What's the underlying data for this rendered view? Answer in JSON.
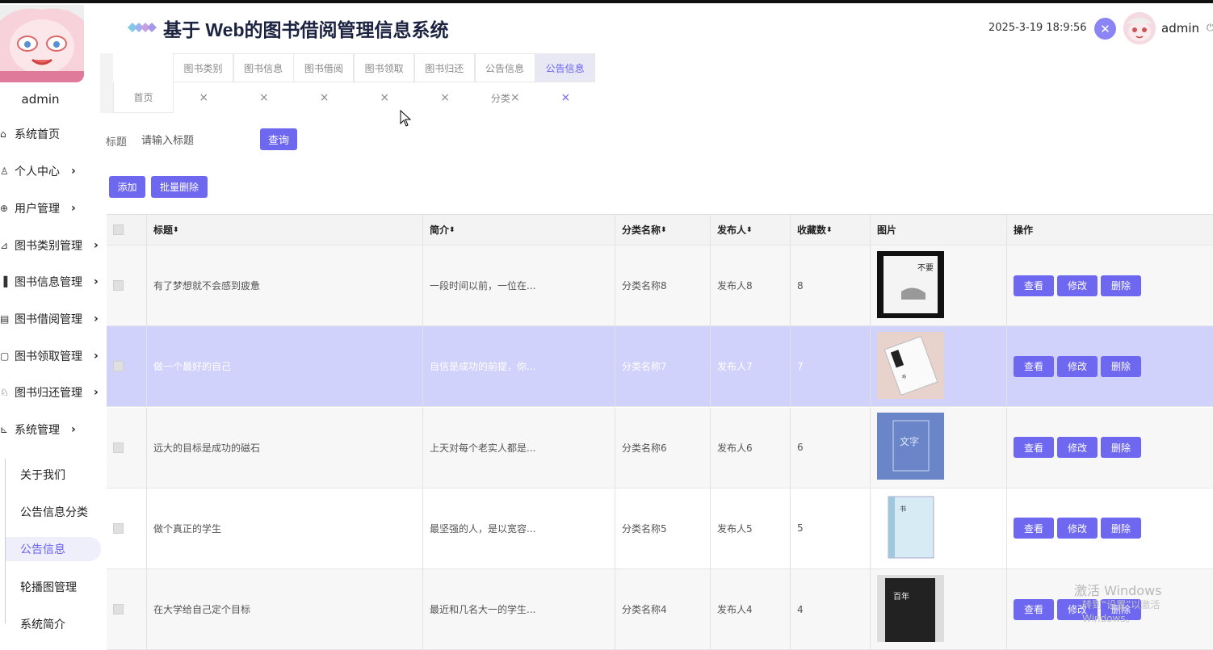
{
  "app": {
    "title": "基于 Web的图书借阅管理信息系统",
    "datetime": "2025-3-19 18:9:56",
    "user": "admin"
  },
  "sidebar": {
    "username": "admin",
    "items": [
      {
        "label": "系统首页",
        "icon": "home-icon",
        "arrow": false
      },
      {
        "label": "个人中心",
        "icon": "user-icon",
        "arrow": true
      },
      {
        "label": "用户管理",
        "icon": "users-icon",
        "arrow": true
      },
      {
        "label": "图书类别管理",
        "icon": "chart-icon",
        "arrow": true
      },
      {
        "label": "图书信息管理",
        "icon": "bar-icon",
        "arrow": true
      },
      {
        "label": "图书借阅管理",
        "icon": "book-icon",
        "arrow": true
      },
      {
        "label": "图书领取管理",
        "icon": "box-icon",
        "arrow": true
      },
      {
        "label": "图书归还管理",
        "icon": "return-icon",
        "arrow": true
      },
      {
        "label": "系统管理",
        "icon": "system-icon",
        "arrow": true
      }
    ],
    "subitems": [
      {
        "label": "关于我们",
        "active": false
      },
      {
        "label": "公告信息分类",
        "active": false
      },
      {
        "label": "公告信息",
        "active": true
      },
      {
        "label": "轮播图管理",
        "active": false
      },
      {
        "label": "系统简介",
        "active": false
      }
    ]
  },
  "tabs_top": [
    {
      "label": "图书类别",
      "active": false
    },
    {
      "label": "图书信息",
      "active": false
    },
    {
      "label": "图书借阅",
      "active": false
    },
    {
      "label": "图书领取",
      "active": false
    },
    {
      "label": "图书归还",
      "active": false
    },
    {
      "label": "公告信息",
      "active": false
    },
    {
      "label": "公告信息",
      "active": true
    }
  ],
  "tabs_bottom": [
    {
      "label": "首页",
      "close": false,
      "active": false
    },
    {
      "label": "",
      "close": true,
      "active": false
    },
    {
      "label": "",
      "close": true,
      "active": false
    },
    {
      "label": "",
      "close": true,
      "active": false
    },
    {
      "label": "",
      "close": true,
      "active": false
    },
    {
      "label": "",
      "close": true,
      "active": false
    },
    {
      "label": "分类",
      "close": true,
      "active": false
    },
    {
      "label": "",
      "close": true,
      "active": true
    }
  ],
  "close_glyph": "×",
  "search": {
    "label": "标题",
    "placeholder": "请输入标题",
    "button": "查询"
  },
  "actions": {
    "add": "添加",
    "batch_delete": "批量删除"
  },
  "table": {
    "headers": [
      "标题",
      "简介",
      "分类名称",
      "发布人",
      "收藏数",
      "图片",
      "操作"
    ],
    "sort_glyph": "⬍",
    "rows": [
      {
        "title": "有了梦想就不会感到疲惫",
        "intro": "一段时间以前，一位在...",
        "category": "分类名称8",
        "publisher": "发布人8",
        "favorites": "8"
      },
      {
        "title": "做一个最好的自己",
        "intro": "自信是成功的前提，你...",
        "category": "分类名称7",
        "publisher": "发布人7",
        "favorites": "7"
      },
      {
        "title": "远大的目标是成功的磁石",
        "intro": "上天对每个老实人都是...",
        "category": "分类名称6",
        "publisher": "发布人6",
        "favorites": "6"
      },
      {
        "title": "做个真正的学生",
        "intro": "最坚强的人，是以宽容...",
        "category": "分类名称5",
        "publisher": "发布人5",
        "favorites": "5"
      },
      {
        "title": "在大学给自己定个目标",
        "intro": "最近和几名大一的学生...",
        "category": "分类名称4",
        "publisher": "发布人4",
        "favorites": "4"
      }
    ],
    "op_labels": {
      "view": "查看",
      "edit": "修改",
      "delete": "删除"
    }
  },
  "watermark": {
    "line1": "激活 Windows",
    "line2": "转到“设置”以激活 Windows。"
  },
  "colors": {
    "accent": "#6e67f0",
    "highlight_row": "#d0d2fb",
    "title": "#1b2340"
  }
}
